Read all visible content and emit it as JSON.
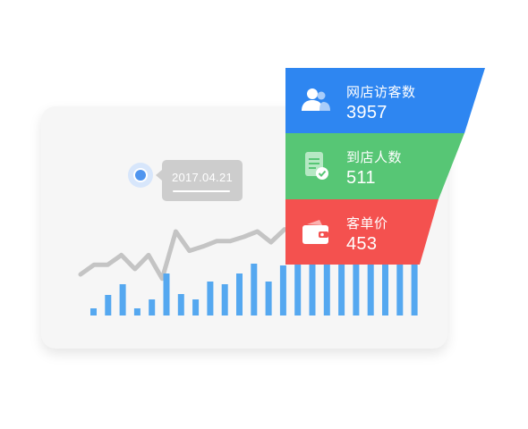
{
  "tooltip": {
    "date": "2017.04.21"
  },
  "funnel": [
    {
      "label": "网店访客数",
      "value": "3957",
      "icon": "users-icon",
      "color": "#2e86f1"
    },
    {
      "label": "到店人数",
      "value": "511",
      "icon": "document-check-icon",
      "color": "#57c675"
    },
    {
      "label": "客单价",
      "value": "453",
      "icon": "wallet-icon",
      "color": "#f4514f"
    }
  ],
  "chart_data": {
    "type": "bar",
    "bar_color": "#55a8f0",
    "line_color": "#c4c4c4",
    "bars": [
      8,
      23,
      35,
      8,
      18,
      47,
      24,
      18,
      38,
      35,
      47,
      58,
      38,
      56,
      62,
      70,
      70,
      70,
      70,
      70,
      70,
      70,
      70
    ],
    "line": [
      10,
      19,
      19,
      28,
      15,
      28,
      6,
      50,
      32,
      36,
      41,
      41,
      45,
      50,
      40,
      52
    ]
  }
}
